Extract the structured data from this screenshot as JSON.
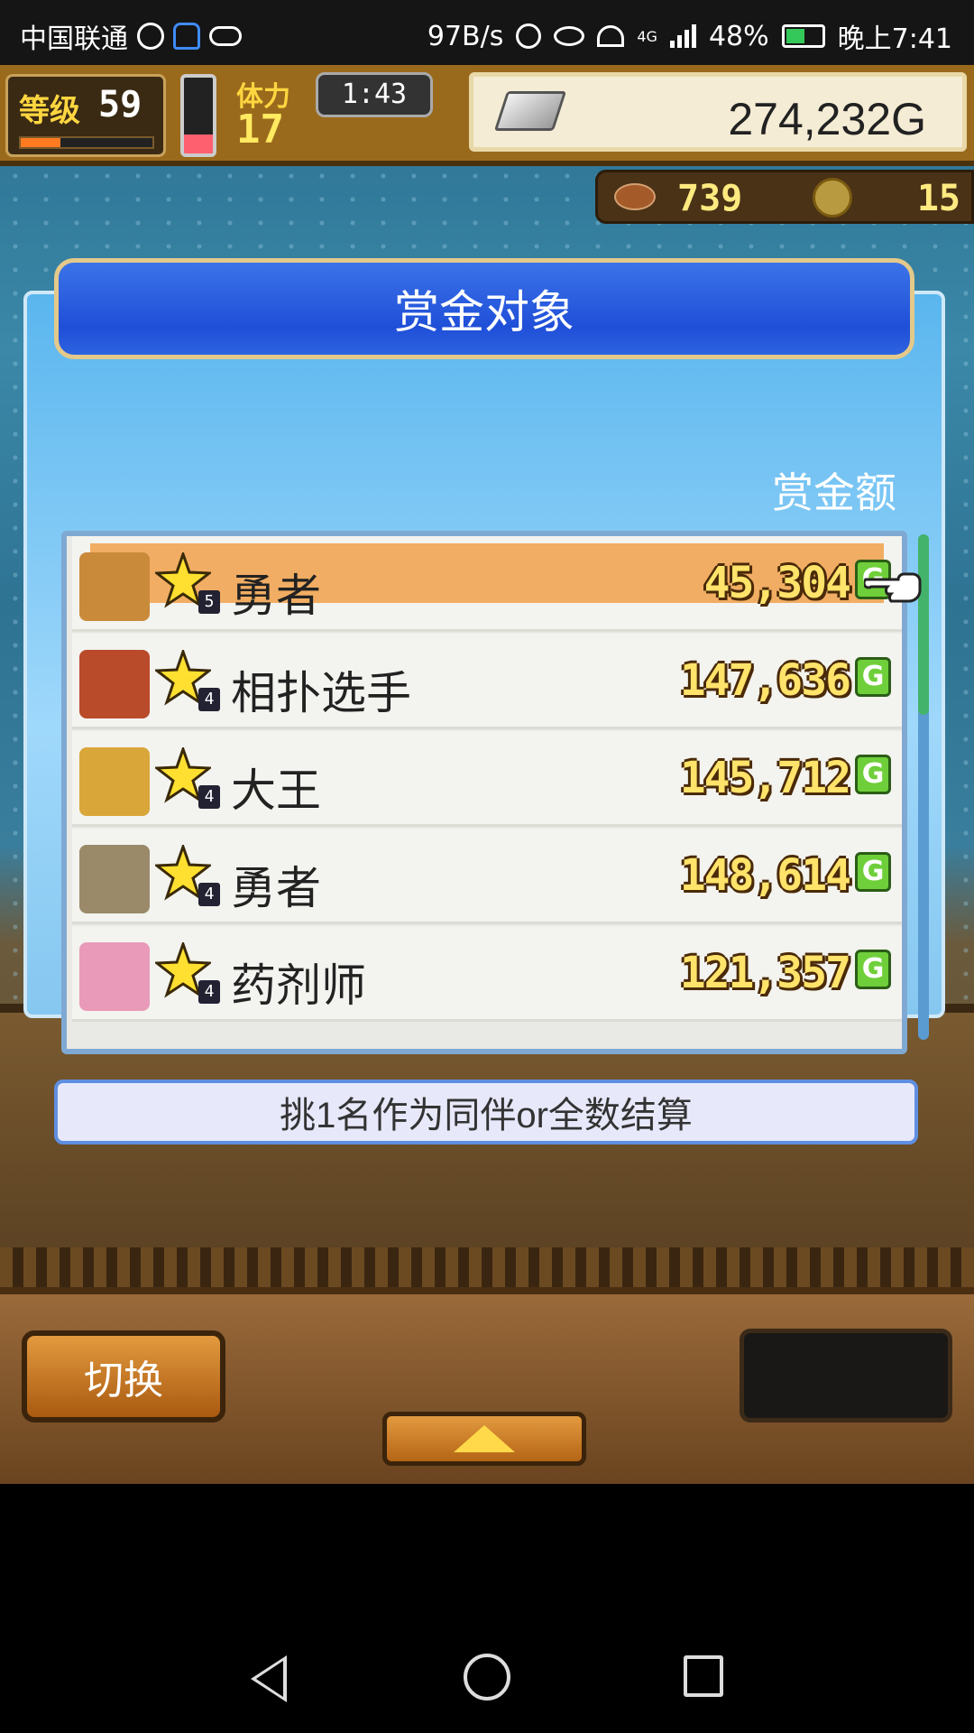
{
  "status_bar": {
    "carrier": "中国联通",
    "net_speed": "97B/s",
    "network": "4G",
    "battery": "48%",
    "time": "晚上7:41"
  },
  "hud": {
    "level_label": "等级",
    "level_value": "59",
    "stamina_label": "体力",
    "stamina_value": "17",
    "timer": "1:43",
    "gold": "274,232G",
    "meat": "739",
    "coins": "15"
  },
  "dialog": {
    "title": "赏金对象",
    "column_header": "赏金额",
    "hint": "挑1名作为同伴or全数结算",
    "currency_icon": "G",
    "rows": [
      {
        "stars": "5",
        "name": "勇者",
        "amount": "45,304",
        "selected": true,
        "avatar_color": "#c98a3a"
      },
      {
        "stars": "4",
        "name": "相扑选手",
        "amount": "147,636",
        "selected": false,
        "avatar_color": "#b94a2a"
      },
      {
        "stars": "4",
        "name": "大王",
        "amount": "145,712",
        "selected": false,
        "avatar_color": "#d9a63a"
      },
      {
        "stars": "4",
        "name": "勇者",
        "amount": "148,614",
        "selected": false,
        "avatar_color": "#9a8a6a"
      },
      {
        "stars": "4",
        "name": "药剂师",
        "amount": "121,357",
        "selected": false,
        "avatar_color": "#e89ab8"
      }
    ]
  },
  "toolbar": {
    "switch_label": "切换"
  },
  "colors": {
    "title_bar": "#1f4fd8",
    "panel": "#5ab6ee",
    "selected_row": "#f1ad63",
    "amount_text": "#ffe36a"
  }
}
